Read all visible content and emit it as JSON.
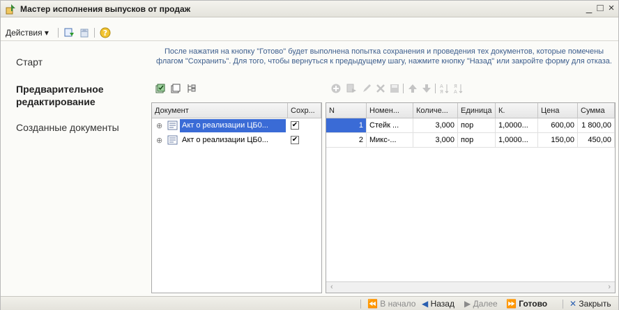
{
  "window": {
    "title": "Мастер исполнения выпусков от продаж",
    "controls": {
      "minimize": "_",
      "maximize": "□",
      "close": "×"
    }
  },
  "toolbar": {
    "actions_label": "Действия",
    "icons": [
      "fill-down-icon",
      "fill-up-icon",
      "help-icon"
    ]
  },
  "nav": {
    "items": [
      {
        "label": "Старт",
        "active": false
      },
      {
        "label": "Предварительное редактирование",
        "active": true
      },
      {
        "label": "Созданные документы",
        "active": false
      }
    ]
  },
  "info_text": "После нажатия на кнопку \"Готово\" будет выполнена попытка сохранения и проведения тех документов, которые помечены флагом \"Сохранить\". Для того, чтобы вернуться к предыдущему шагу, нажмите кнопку \"Назад\" или закройте форму для отказа.",
  "doc_table": {
    "tool_icons": [
      "check-all-icon",
      "uncheck-all-icon",
      "tree-icon"
    ],
    "columns": [
      "Документ",
      "Сохр..."
    ],
    "rows": [
      {
        "expander": "⊕",
        "name": "Акт о реализации ЦБ0...",
        "checked": true,
        "selected": true
      },
      {
        "expander": "⊕",
        "name": "Акт о реализации ЦБ0...",
        "checked": true,
        "selected": false
      }
    ]
  },
  "detail_table": {
    "tool_icons": [
      "add-icon",
      "copy-icon",
      "edit-icon",
      "delete-icon",
      "save-icon",
      "move-up-icon",
      "move-down-icon",
      "sort-asc-icon",
      "sort-desc-icon"
    ],
    "columns": [
      "N",
      "Номен...",
      "Количе...",
      "Единица",
      "К.",
      "Цена",
      "Сумма"
    ],
    "rows": [
      {
        "n": "1",
        "item": "Стейк ...",
        "qty": "3,000",
        "unit": "пор",
        "k": "1,0000...",
        "price": "600,00",
        "sum": "1 800,00"
      },
      {
        "n": "2",
        "item": "Микс-...",
        "qty": "3,000",
        "unit": "пор",
        "k": "1,0000...",
        "price": "150,00",
        "sum": "450,00"
      }
    ]
  },
  "footer": {
    "start": "В начало",
    "back": "Назад",
    "next": "Далее",
    "done": "Готово",
    "close": "Закрыть"
  },
  "colors": {
    "info_text": "#3c5d8c",
    "selection": "#3a6bd6"
  }
}
